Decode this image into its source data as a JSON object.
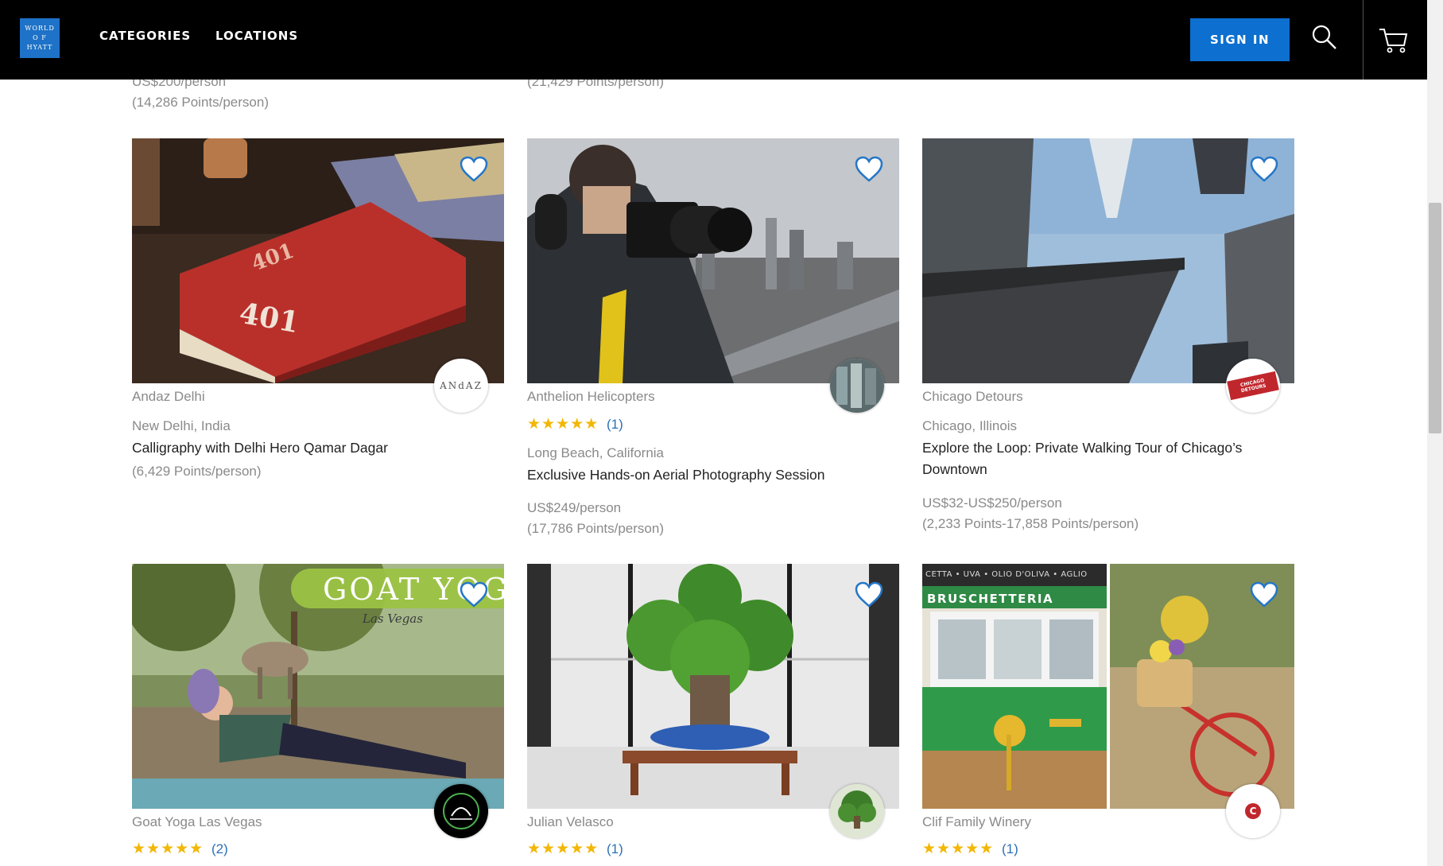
{
  "header": {
    "logo_lines": [
      "WORLD",
      "O F",
      "HYATT"
    ],
    "nav": [
      "CATEGORIES",
      "LOCATIONS"
    ],
    "signin_label": "SIGN IN",
    "icons": [
      "search-icon",
      "cart-icon"
    ]
  },
  "prev_row": {
    "left_price": "US$200/person",
    "left_points": "(14,286 Points/person)",
    "mid_points": "(21,429 Points/person)"
  },
  "cards": [
    {
      "vendor": "Andaz Delhi",
      "location": "New Delhi, India",
      "title": [
        "Calligraphy with Delhi Hero Qamar Dagar"
      ],
      "points": "(6,429 Points/person)",
      "badge_text": "ANdAZ",
      "book_label": "401"
    },
    {
      "vendor": "Anthelion Helicopters",
      "stars": "★★★★★",
      "rating_count": "(1)",
      "location": "Long Beach, California",
      "title": [
        "Exclusive Hands-on Aerial Photography Session"
      ],
      "price": "US$249/person",
      "points": "(17,786 Points/person)"
    },
    {
      "vendor": "Chicago Detours",
      "location": "Chicago, Illinois",
      "title": [
        "Explore the Loop: Private Walking Tour of Chicago’s",
        "Downtown"
      ],
      "price": "US$32-US$250/person",
      "points": "(2,233 Points-17,858 Points/person)",
      "badge_text": "CHICAGO DETOURS"
    },
    {
      "vendor": "Goat Yoga Las Vegas",
      "stars": "★★★★★",
      "rating_count": "(2)",
      "sign_text": "GOAT YOGA",
      "sign_sub": "Las Vegas"
    },
    {
      "vendor": "Julian Velasco",
      "stars": "★★★★★",
      "rating_count": "(1)"
    },
    {
      "vendor": "Clif Family Winery",
      "stars": "★★★★★",
      "rating_count": "(1)",
      "awning_top": "CETTA • UVA • OLIO D'OLIVA • AGLIO",
      "sign_text": "BRUSCHETTERIA",
      "badge_text": "C"
    }
  ],
  "colors": {
    "header_bg": "#000000",
    "signin_bg": "#0d6fcf",
    "star": "#f2b705",
    "rating_link": "#2d6fb6",
    "muted_text": "#8a8a8a"
  }
}
